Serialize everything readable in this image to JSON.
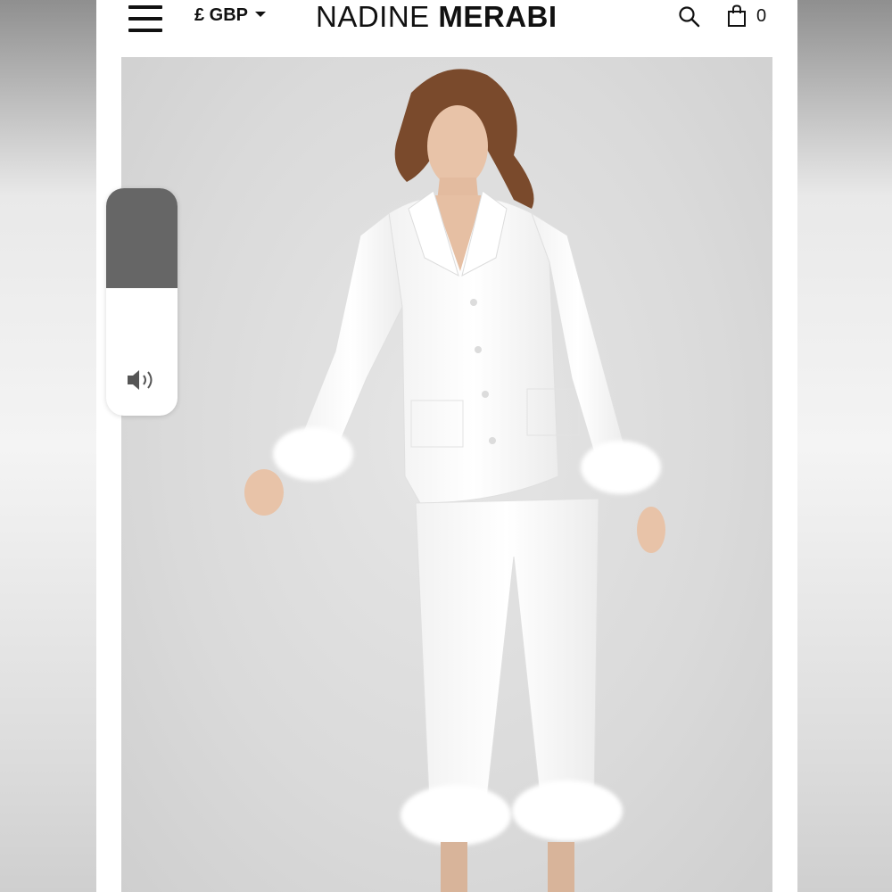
{
  "header": {
    "currency_label": "£ GBP",
    "brand_light": "NADINE",
    "brand_bold": "MERABI",
    "cart_count": "0"
  },
  "icons": {
    "menu": "hamburger-menu-icon",
    "currency_dropdown": "chevron-down-icon",
    "search": "search-icon",
    "cart": "shopping-bag-icon",
    "volume": "speaker-icon"
  },
  "product_image": {
    "subject": "white satin pajama set with feather cuffs"
  },
  "volume_overlay": {
    "level": 0.56
  },
  "colors": {
    "brand_text": "#111111",
    "volume_fill": "#666666",
    "photo_background": "#dadada"
  }
}
